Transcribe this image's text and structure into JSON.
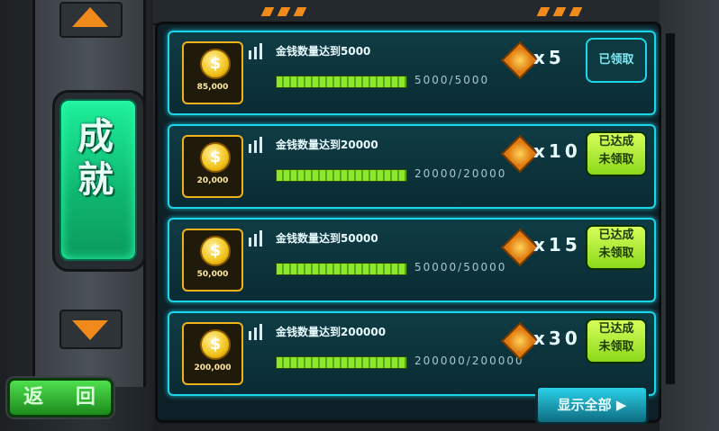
{
  "left_panel": {
    "title": "成就",
    "back_label": "返 回"
  },
  "achievements": [
    {
      "coin_amount": "85,000",
      "task": "金钱数量达到5000",
      "progress": "5000/5000",
      "progress_fraction": 1.0,
      "reward": "x5",
      "status_lines": [
        "已领取"
      ],
      "status": "claimed"
    },
    {
      "coin_amount": "20,000",
      "task": "金钱数量达到20000",
      "progress": "20000/20000",
      "progress_fraction": 1.0,
      "reward": "x10",
      "status_lines": [
        "已达成",
        "未领取"
      ],
      "status": "available"
    },
    {
      "coin_amount": "50,000",
      "task": "金钱数量达到50000",
      "progress": "50000/50000",
      "progress_fraction": 1.0,
      "reward": "x15",
      "status_lines": [
        "已达成",
        "未领取"
      ],
      "status": "available"
    },
    {
      "coin_amount": "200,000",
      "task": "金钱数量达到200000",
      "progress": "200000/200000",
      "progress_fraction": 1.0,
      "reward": "x30",
      "status_lines": [
        "已达成",
        "未领取"
      ],
      "status": "available"
    }
  ],
  "footer": {
    "show_all_label": "显示全部 ▶"
  },
  "icons": {
    "coin": "coin-icon",
    "reward": "gem-icon",
    "scroll_up": "arrow-up-icon",
    "scroll_down": "arrow-down-icon"
  },
  "colors": {
    "accent_cyan": "#1ad6e8",
    "title_green": "#1df09a",
    "claim_available": "#b8f03a",
    "arrow_orange": "#f08a1a",
    "coin_gold": "#f2c21a"
  }
}
